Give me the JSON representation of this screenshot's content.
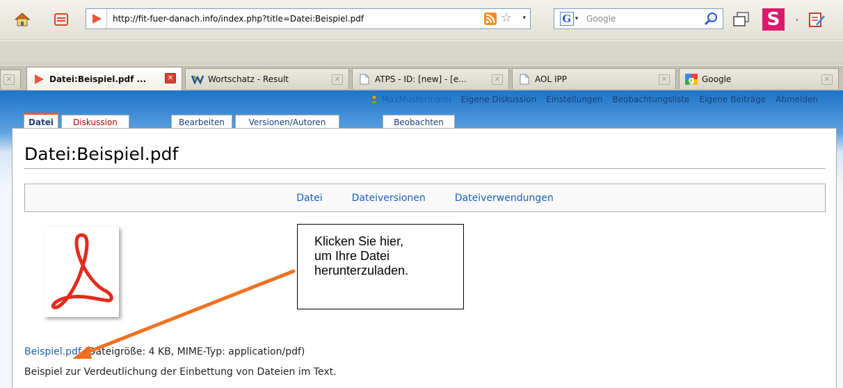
{
  "toolbar": {
    "url": "http://fit-fuer-danach.info/index.php?title=Datei:Beispiel.pdf",
    "search_placeholder": "Google"
  },
  "tabs": [
    {
      "label": "Datei:Beispiel.pdf ...",
      "active": true
    },
    {
      "label": "Wortschatz - Result"
    },
    {
      "label": "ATPS - ID: [new] - [e..."
    },
    {
      "label": "AOL IPP"
    },
    {
      "label": "Google"
    }
  ],
  "personal": {
    "user": "MaxMustermann",
    "links": [
      "Eigene Diskussion",
      "Einstellungen",
      "Beobachtungsliste",
      "Eigene Beiträge",
      "Abmelden"
    ]
  },
  "page_tabs": [
    "Datei",
    "Diskussion",
    "Bearbeiten",
    "Versionen/Autoren",
    "Beobachten"
  ],
  "page": {
    "title": "Datei:Beispiel.pdf",
    "file_toc": [
      "Datei",
      "Dateiversionen",
      "Dateiverwendungen"
    ],
    "file_link": "Beispiel.pdf",
    "file_info": " (Dateigröße: 4 KB, MIME-Typ: application/pdf)",
    "description": "Beispiel zur Verdeutlichung der Einbettung von Dateien im Text."
  },
  "callout": {
    "lines": [
      "Klicken Sie hier,",
      "um Ihre Datei",
      "herunterzuladen."
    ],
    "arrow_color": "#f07020"
  },
  "colors": {
    "link": "#1a5fb4",
    "new_link": "#ba0000",
    "header_blue": "#1d74c8"
  }
}
